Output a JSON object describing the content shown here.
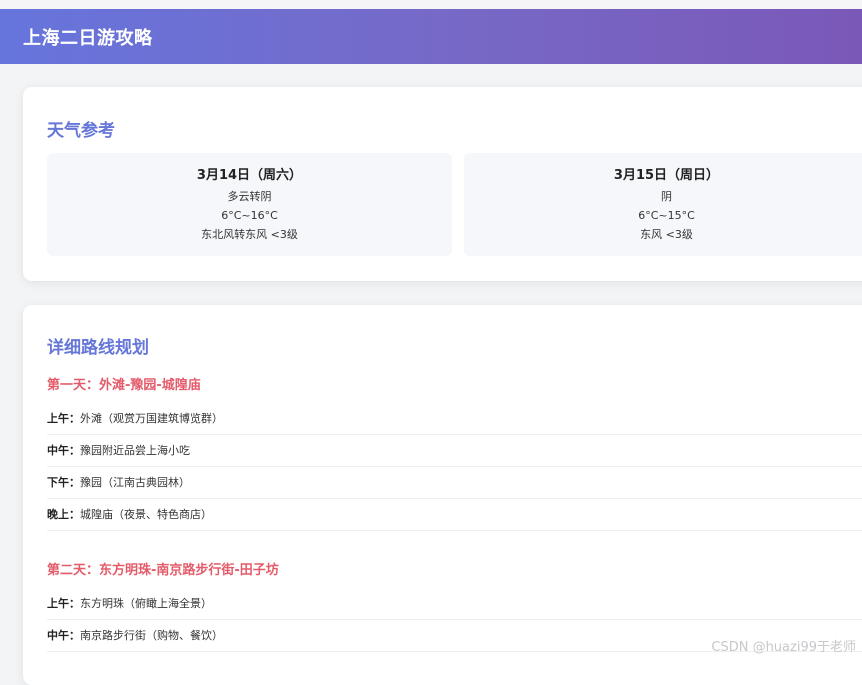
{
  "header": {
    "title": "上海二日游攻略"
  },
  "weather": {
    "title": "天气参考",
    "days": [
      {
        "date": "3月14日（周六）",
        "condition": "多云转阴",
        "temp": "6°C~16°C",
        "wind": "东北风转东风 <3级"
      },
      {
        "date": "3月15日（周日）",
        "condition": "阴",
        "temp": "6°C~15°C",
        "wind": "东风 <3级"
      }
    ]
  },
  "route": {
    "title": "详细路线规划",
    "days": [
      {
        "title": "第一天：外滩-豫园-城隍庙",
        "items": [
          {
            "time": "上午：",
            "text": "外滩（观赏万国建筑博览群）"
          },
          {
            "time": "中午：",
            "text": "豫园附近品尝上海小吃"
          },
          {
            "time": "下午：",
            "text": "豫园（江南古典园林）"
          },
          {
            "time": "晚上：",
            "text": "城隍庙（夜景、特色商店）"
          }
        ]
      },
      {
        "title": "第二天：东方明珠-南京路步行街-田子坊",
        "items": [
          {
            "time": "上午：",
            "text": "东方明珠（俯瞰上海全景）"
          },
          {
            "time": "中午：",
            "text": "南京路步行街（购物、餐饮）"
          }
        ]
      }
    ]
  },
  "watermark": "CSDN @huazi99于老师"
}
